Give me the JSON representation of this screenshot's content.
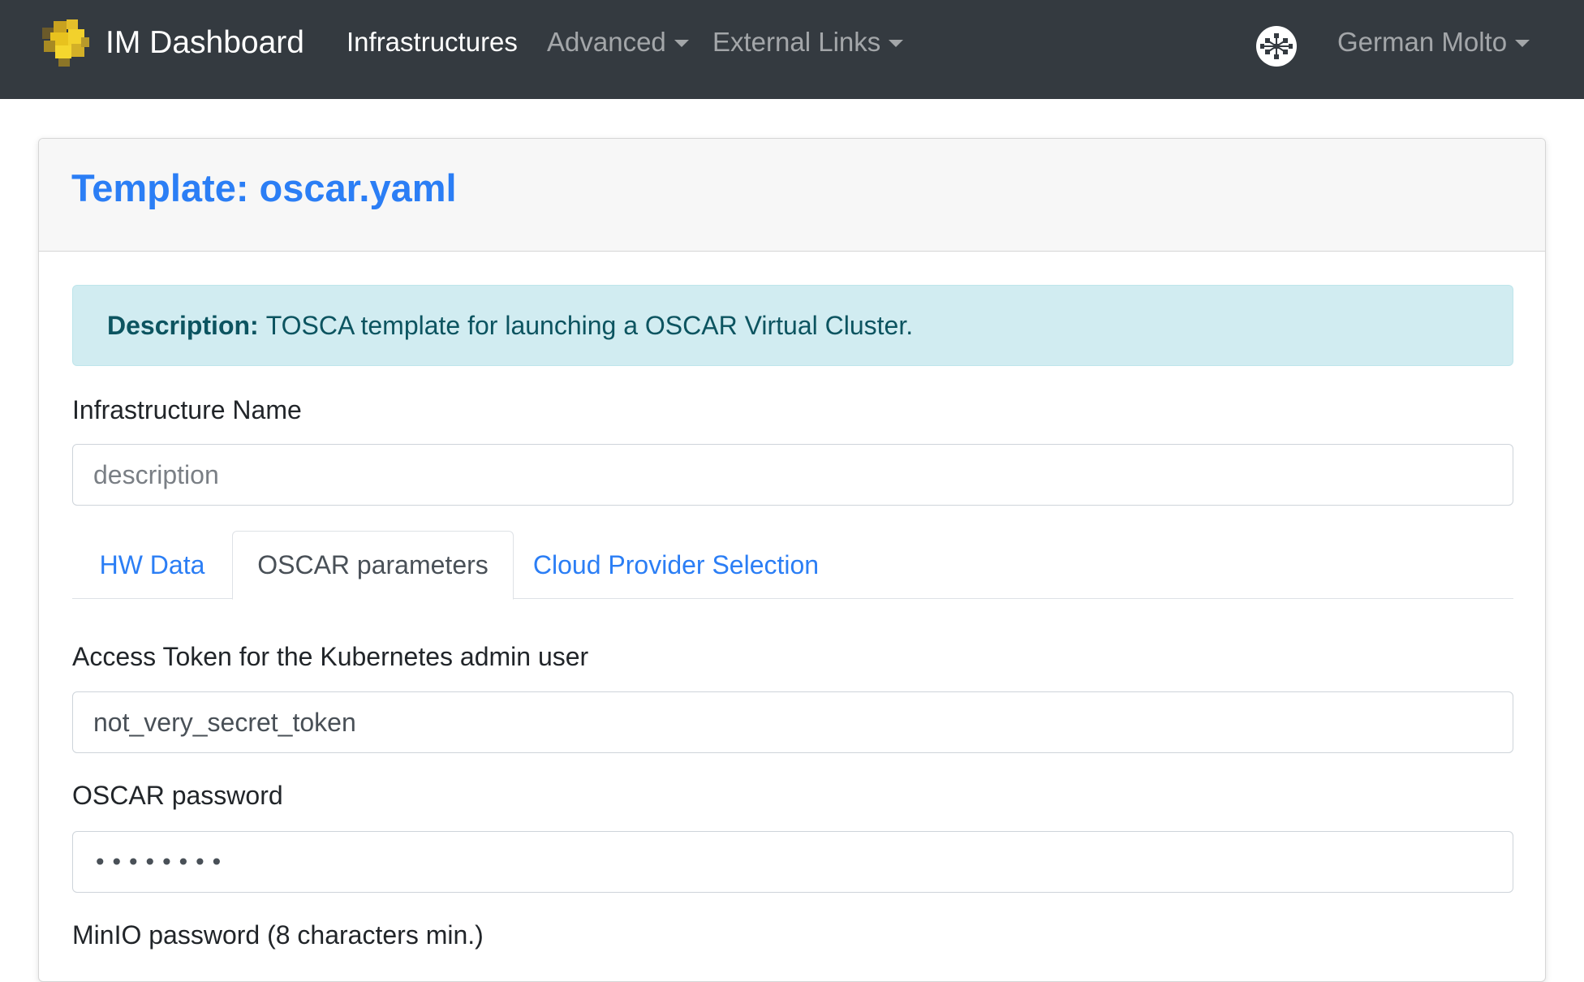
{
  "navbar": {
    "brand": "IM Dashboard",
    "links": [
      {
        "label": "Infrastructures",
        "active": true,
        "dropdown": false
      },
      {
        "label": "Advanced",
        "active": false,
        "dropdown": true
      },
      {
        "label": "External Links",
        "active": false,
        "dropdown": true
      }
    ],
    "user": "German Molto"
  },
  "card": {
    "title": "Template: oscar.yaml",
    "description_label": "Description:",
    "description": "TOSCA template for launching a OSCAR Virtual Cluster."
  },
  "form": {
    "infra_name_label": "Infrastructure Name",
    "infra_name_placeholder": "description",
    "tabs": [
      {
        "label": "HW Data",
        "active": false
      },
      {
        "label": "OSCAR parameters",
        "active": true
      },
      {
        "label": "Cloud Provider Selection",
        "active": false
      }
    ],
    "token_label": "Access Token for the Kubernetes admin user",
    "token_value": "not_very_secret_token",
    "oscar_password_label": "OSCAR password",
    "oscar_password_value": "••••••••",
    "minio_password_label": "MinIO password (8 characters min.)"
  },
  "colors": {
    "navbar_bg": "#343a40",
    "link": "#2b7ef5",
    "alert_bg": "#d1ecf1",
    "alert_text": "#0c5460"
  }
}
